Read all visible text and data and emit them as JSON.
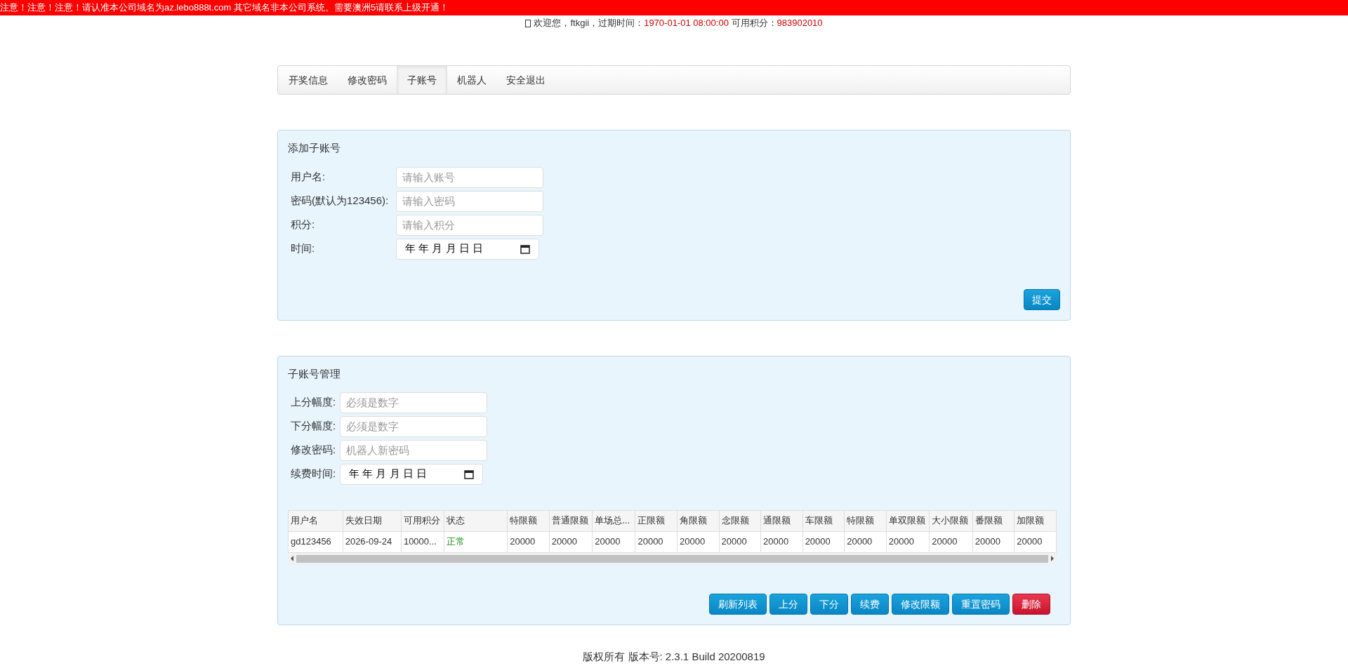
{
  "notice": "注意！注意！注意！请认准本公司域名为az.lebo888t.com 其它域名非本公司系统。需要澳洲5请联系上级开通！",
  "welcome": {
    "greeting": "欢迎您，ftkgii，过期时间：",
    "expiry": "1970-01-01 08:00:00",
    "points_label": "可用积分：",
    "points": "983902010"
  },
  "tabs": [
    {
      "label": "开奖信息",
      "selected": false
    },
    {
      "label": "修改密码",
      "selected": false
    },
    {
      "label": "子账号",
      "selected": true
    },
    {
      "label": "机器人",
      "selected": false
    },
    {
      "label": "安全退出",
      "selected": false
    }
  ],
  "add_panel": {
    "title": "添加子账号",
    "fields": [
      {
        "label": "用户名:",
        "kind": "text",
        "placeholder": "请输入账号"
      },
      {
        "label": "密码(默认为123456):",
        "kind": "text",
        "placeholder": "请输入密码"
      },
      {
        "label": "积分:",
        "kind": "text",
        "placeholder": "请输入积分"
      },
      {
        "label": "时间:",
        "kind": "date",
        "value": "年 年 月 月 日 日"
      }
    ],
    "submit": "提交"
  },
  "manage_panel": {
    "title": "子账号管理",
    "fields": [
      {
        "label": "上分幅度:",
        "kind": "text",
        "placeholder": "必须是数字"
      },
      {
        "label": "下分幅度:",
        "kind": "text",
        "placeholder": "必须是数字"
      },
      {
        "label": "修改密码:",
        "kind": "text",
        "placeholder": "机器人新密码"
      },
      {
        "label": "续费时间:",
        "kind": "date",
        "value": "年 年 月 月 日 日"
      }
    ],
    "table": {
      "columns": [
        "用户名",
        "失效日期",
        "可用积分",
        "状态",
        "特限额",
        "普通限额",
        "单场总...",
        "正限额",
        "角限额",
        "念限额",
        "通限额",
        "车限额",
        "特限额",
        "单双限额",
        "大小限额",
        "番限额",
        "加限额"
      ],
      "rows": [
        {
          "cells": [
            "gd123456",
            "2026-09-24",
            "10000...",
            "正常",
            "20000",
            "20000",
            "20000",
            "20000",
            "20000",
            "20000",
            "20000",
            "20000",
            "20000",
            "20000",
            "20000",
            "20000",
            "20000"
          ],
          "status_ok": true
        }
      ]
    },
    "buttons": [
      {
        "label": "刷新列表",
        "kind": "primary"
      },
      {
        "label": "上分",
        "kind": "primary"
      },
      {
        "label": "下分",
        "kind": "primary"
      },
      {
        "label": "续费",
        "kind": "primary"
      },
      {
        "label": "修改限额",
        "kind": "primary"
      },
      {
        "label": "重置密码",
        "kind": "primary"
      },
      {
        "label": "删除",
        "kind": "danger"
      }
    ]
  },
  "footer": "版权所有 版本号: 2.3.1 Build 20200819"
}
